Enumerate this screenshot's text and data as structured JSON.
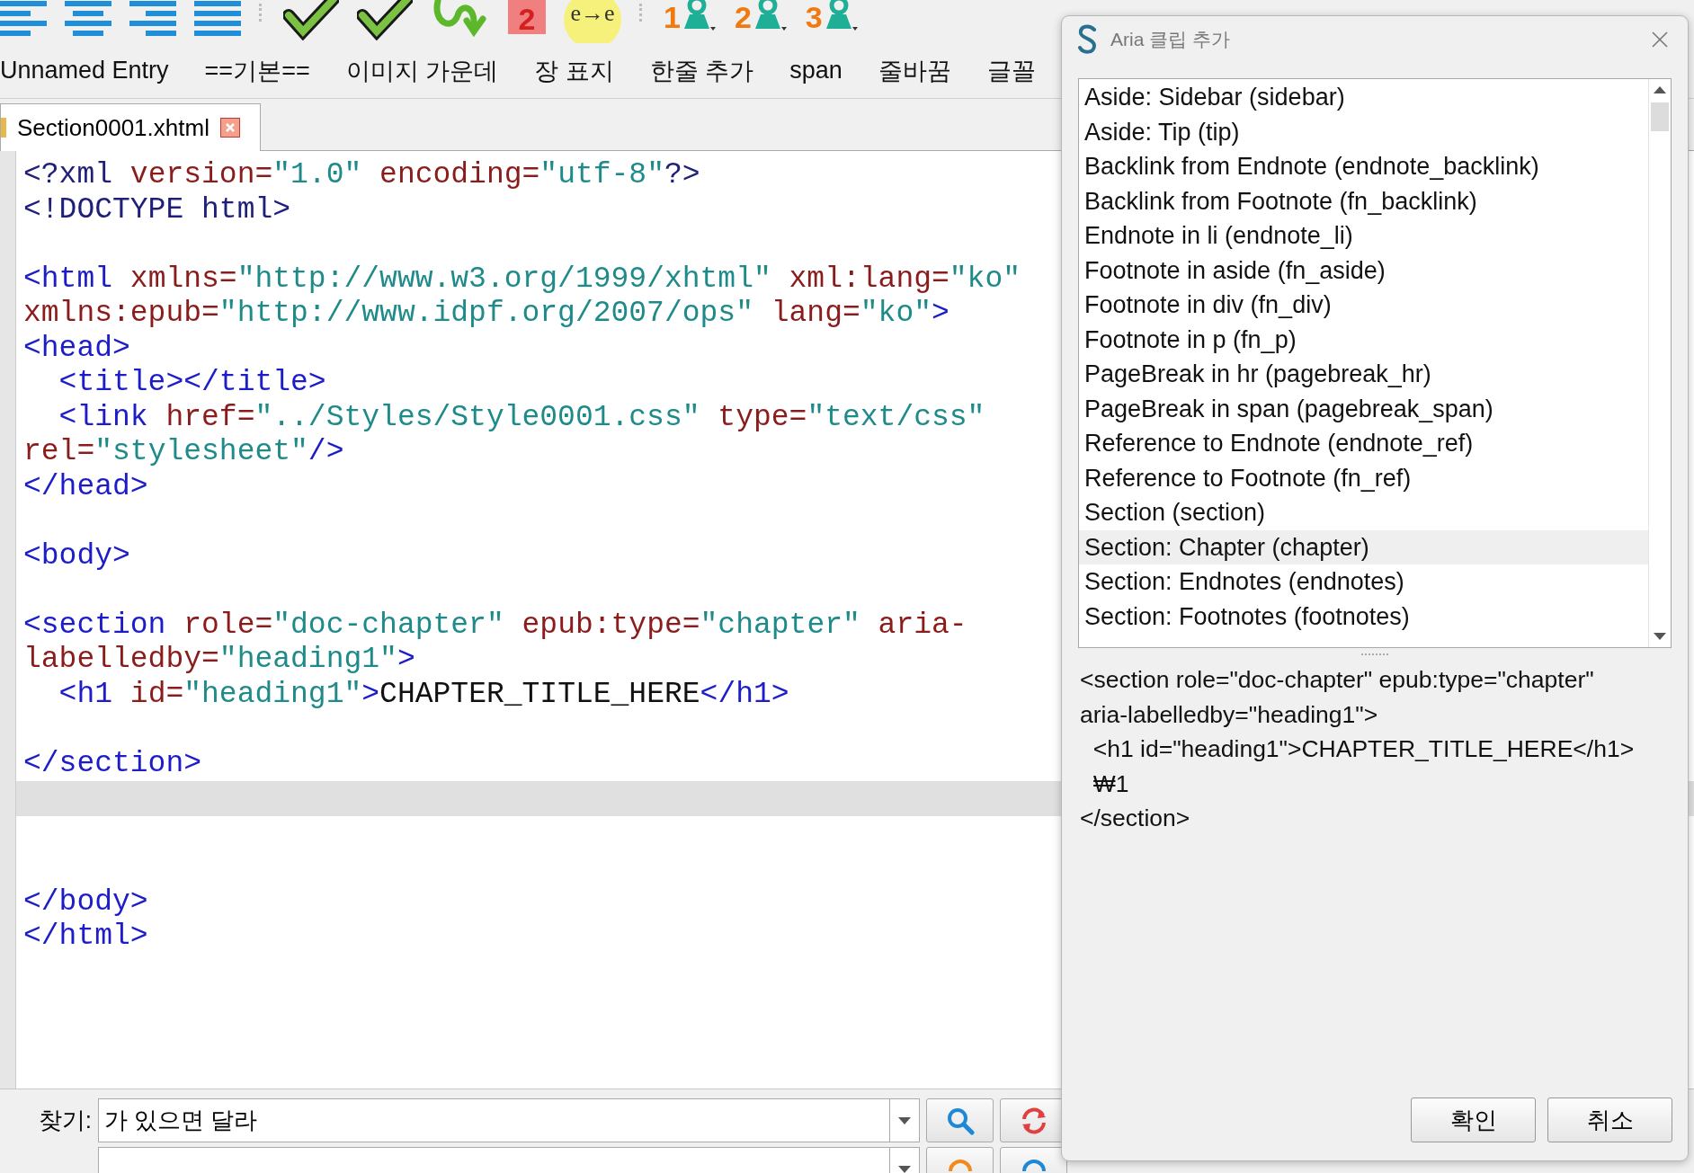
{
  "toolbar": [
    {
      "kind": "align_left"
    },
    {
      "kind": "align_center"
    },
    {
      "kind": "align_right"
    },
    {
      "kind": "justify"
    },
    {
      "kind": "separator"
    },
    {
      "kind": "check"
    },
    {
      "kind": "check"
    },
    {
      "kind": "arrow"
    },
    {
      "kind": "badge",
      "label": "2"
    },
    {
      "kind": "formula",
      "label": "e→e"
    },
    {
      "kind": "separator"
    },
    {
      "kind": "person",
      "label": "1"
    },
    {
      "kind": "person",
      "label": "2"
    },
    {
      "kind": "person",
      "label": "3"
    }
  ],
  "clips": [
    "Unnamed Entry",
    "==기본==",
    "이미지 가운데",
    "장 표지",
    "한줄 추가",
    "span",
    "줄바꿈",
    "글꼴"
  ],
  "tabs": [
    {
      "label": "Section0001.xhtml",
      "selected": true
    }
  ],
  "editor": {
    "rows": [
      {
        "current": false,
        "tokens": [
          {
            "kind": "decl",
            "text": "<?xml"
          },
          {
            "kind": "attr",
            "text": " version="
          },
          {
            "kind": "value",
            "text": "\"1.0\""
          },
          {
            "kind": "attr",
            "text": " encoding="
          },
          {
            "kind": "value",
            "text": "\"utf-8\""
          },
          {
            "kind": "decl",
            "text": "?>"
          }
        ]
      },
      {
        "current": false,
        "tokens": [
          {
            "kind": "decl",
            "text": "<!DOCTYPE html>"
          }
        ]
      },
      {
        "current": false
      },
      {
        "current": false,
        "tokens": [
          {
            "kind": "tag",
            "text": "<html"
          },
          {
            "kind": "attr",
            "text": " xmlns="
          },
          {
            "kind": "value",
            "text": "\"http://www.w3.org/1999/xhtml\""
          },
          {
            "kind": "attr",
            "text": " xml:lang="
          },
          {
            "kind": "value",
            "text": "\"ko\""
          }
        ]
      },
      {
        "current": false,
        "tokens": [
          {
            "kind": "attr",
            "text": "xmlns:epub="
          },
          {
            "kind": "value",
            "text": "\"http://www.idpf.org/2007/ops\""
          },
          {
            "kind": "attr",
            "text": " lang="
          },
          {
            "kind": "value",
            "text": "\"ko\""
          },
          {
            "kind": "tag",
            "text": ">"
          }
        ]
      },
      {
        "current": false,
        "tokens": [
          {
            "kind": "tag",
            "text": "<head>"
          }
        ]
      },
      {
        "current": false,
        "tokens": [
          {
            "kind": "tag",
            "text": "  <title></title>"
          }
        ]
      },
      {
        "current": false,
        "tokens": [
          {
            "kind": "tag",
            "text": "  <link"
          },
          {
            "kind": "attr",
            "text": " href="
          },
          {
            "kind": "value",
            "text": "\"../Styles/Style0001.css\""
          },
          {
            "kind": "attr",
            "text": " type="
          },
          {
            "kind": "value",
            "text": "\"text/css\""
          }
        ]
      },
      {
        "current": false,
        "tokens": [
          {
            "kind": "attr",
            "text": "rel="
          },
          {
            "kind": "value",
            "text": "\"stylesheet\""
          },
          {
            "kind": "tag",
            "text": "/>"
          }
        ]
      },
      {
        "current": false,
        "tokens": [
          {
            "kind": "tag",
            "text": "</head>"
          }
        ]
      },
      {
        "current": false
      },
      {
        "current": false,
        "tokens": [
          {
            "kind": "tag",
            "text": "<body>"
          }
        ]
      },
      {
        "current": false
      },
      {
        "current": false,
        "tokens": [
          {
            "kind": "tag",
            "text": "<section"
          },
          {
            "kind": "attr",
            "text": " role="
          },
          {
            "kind": "value",
            "text": "\"doc-chapter\""
          },
          {
            "kind": "attr",
            "text": " epub:type="
          },
          {
            "kind": "value",
            "text": "\"chapter\""
          },
          {
            "kind": "attr",
            "text": " aria-"
          }
        ]
      },
      {
        "current": false,
        "tokens": [
          {
            "kind": "attr",
            "text": "labelledby="
          },
          {
            "kind": "value",
            "text": "\"heading1\""
          },
          {
            "kind": "tag",
            "text": ">"
          }
        ]
      },
      {
        "current": false,
        "tokens": [
          {
            "kind": "tag",
            "text": "  <h1"
          },
          {
            "kind": "attr",
            "text": " id="
          },
          {
            "kind": "value",
            "text": "\"heading1\""
          },
          {
            "kind": "tag",
            "text": ">"
          },
          {
            "kind": "text",
            "text": "CHAPTER_TITLE_HERE"
          },
          {
            "kind": "tag",
            "text": "</h1>"
          }
        ]
      },
      {
        "current": false
      },
      {
        "current": false,
        "tokens": [
          {
            "kind": "tag",
            "text": "</section>"
          }
        ]
      },
      {
        "current": true
      },
      {
        "current": false
      },
      {
        "current": false
      },
      {
        "current": false,
        "tokens": [
          {
            "kind": "tag",
            "text": "</body>"
          }
        ]
      },
      {
        "current": false,
        "tokens": [
          {
            "kind": "tag",
            "text": "</html>"
          }
        ]
      }
    ]
  },
  "find": {
    "label": "찾기:",
    "value": "가 있으면 달라"
  },
  "dialog": {
    "title": "Aria 클립 추가",
    "items": [
      {
        "label": "Aside: Sidebar (sidebar)",
        "selected": false
      },
      {
        "label": "Aside: Tip (tip)",
        "selected": false
      },
      {
        "label": "Backlink from Endnote (endnote_backlink)",
        "selected": false
      },
      {
        "label": "Backlink from Footnote (fn_backlink)",
        "selected": false
      },
      {
        "label": "Endnote in li (endnote_li)",
        "selected": false
      },
      {
        "label": "Footnote in aside (fn_aside)",
        "selected": false
      },
      {
        "label": "Footnote in div (fn_div)",
        "selected": false
      },
      {
        "label": "Footnote in p (fn_p)",
        "selected": false
      },
      {
        "label": "PageBreak in hr (pagebreak_hr)",
        "selected": false
      },
      {
        "label": "PageBreak in span (pagebreak_span)",
        "selected": false
      },
      {
        "label": "Reference to Endnote (endnote_ref)",
        "selected": false
      },
      {
        "label": "Reference to Footnote (fn_ref)",
        "selected": false
      },
      {
        "label": "Section (section)",
        "selected": false
      },
      {
        "label": "Section: Chapter (chapter)",
        "selected": true
      },
      {
        "label": "Section: Endnotes (endnotes)",
        "selected": false
      },
      {
        "label": "Section: Footnotes (footnotes)",
        "selected": false
      }
    ],
    "preview": [
      "<section role=\"doc-chapter\" epub:type=\"chapter\"",
      "aria-labelledby=\"heading1\">",
      "  <h1 id=\"heading1\">CHAPTER_TITLE_HERE</h1>",
      "  ₩1",
      "</section>"
    ],
    "buttons": [
      "확인",
      "취소"
    ]
  }
}
